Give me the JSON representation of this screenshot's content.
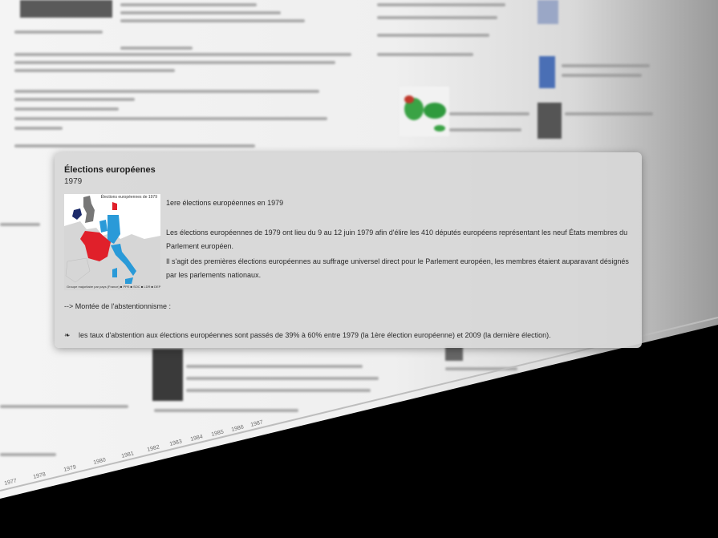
{
  "popup": {
    "title": "Élections européenes",
    "year": "1979",
    "map_title": "Élections européennes de 1979",
    "map_legend": "Groupe majoritaire par pays (France)   ■ PPE  ■ SOC  ■ LDR  ■ DEP",
    "heading": "1ere élections européennes en 1979",
    "paragraph1": "Les élections européennes de 1979 ont lieu du 9 au 12 juin 1979 afin d'élire les 410 députés européens représentant les neuf États membres du Parlement européen.",
    "paragraph2": "Il s'agit des premières élections européennes au suffrage universel direct pour le Parlement européen, les membres étaient auparavant désignés par les parlements nationaux.",
    "subheading": "--> Montée de l'abstentionnisme :",
    "bullet_symbol": "❧",
    "bullet_text": "les taux d'abstention aux élections européennes sont passés de 39% à  60% entre 1979 (la 1ère élection européenne) et 2009 (la dernière  élection)."
  },
  "background": {
    "timeline_years": [
      "1977",
      "1978",
      "1979",
      "1980",
      "1981",
      "1982",
      "1983",
      "1984",
      "1985",
      "1986",
      "1987"
    ]
  },
  "colors": {
    "popup_bg": "#d7d7d7",
    "map_red": "#e0202a",
    "map_blue": "#2a9ad8",
    "map_grey": "#777777",
    "map_navy": "#1c2a6a"
  }
}
